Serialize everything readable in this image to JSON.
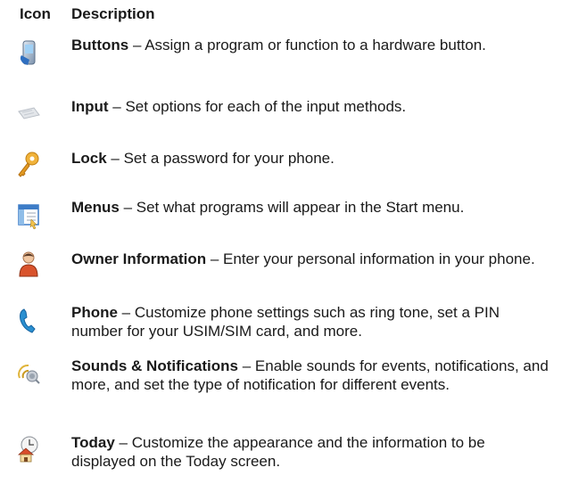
{
  "header": {
    "icon": "Icon",
    "description": "Description"
  },
  "rows": [
    {
      "name": "Buttons",
      "dash": " – ",
      "text": "Assign a program or function to a hardware button.",
      "icon": "phone-device-icon"
    },
    {
      "name": "Input",
      "dash": " – ",
      "text": "Set options for each of the input methods.",
      "icon": "keyboard-icon"
    },
    {
      "name": "Lock",
      "dash": " – ",
      "text": "Set a password for your phone.",
      "icon": "key-icon"
    },
    {
      "name": "Menus",
      "dash": " – ",
      "text": "Set what programs will appear in the Start menu.",
      "icon": "menu-window-icon"
    },
    {
      "name": "Owner Information",
      "dash": " – ",
      "text": "Enter your personal information in your phone.",
      "icon": "owner-person-icon"
    },
    {
      "name": "Phone",
      "dash": " – ",
      "text": "Customize phone settings such as ring tone, set a PIN number for your USIM/SIM card, and more.",
      "icon": "handset-icon"
    },
    {
      "name": "Sounds & Notifications",
      "dash": " – ",
      "text": "Enable sounds for events, notifications, and more, and set the type of notification for different events.",
      "icon": "sound-notification-icon"
    },
    {
      "name": "Today",
      "dash": " – ",
      "text": "Customize the appearance and the information to be displayed on the Today screen.",
      "icon": "today-home-icon"
    }
  ]
}
